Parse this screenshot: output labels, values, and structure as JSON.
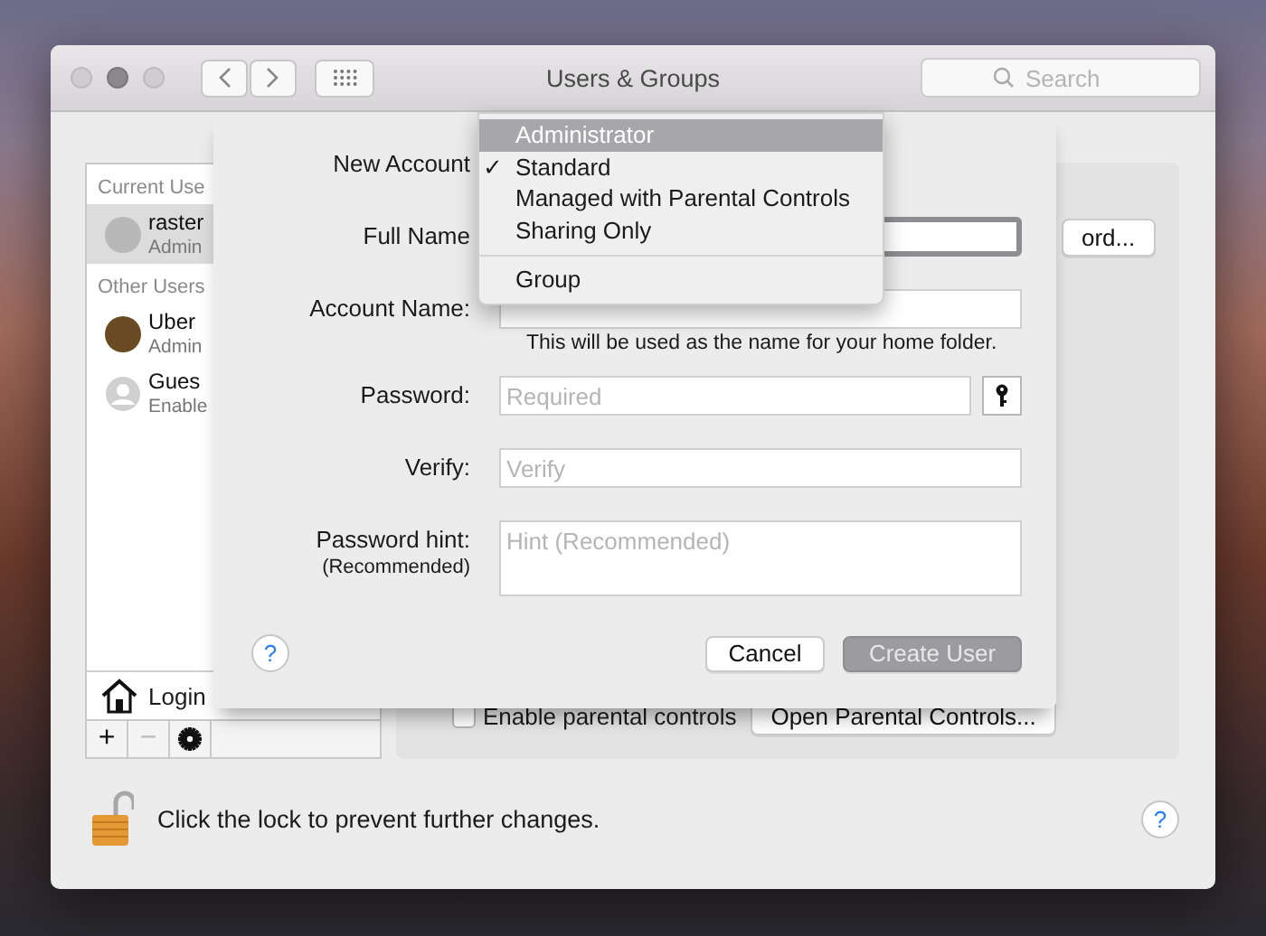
{
  "window": {
    "title": "Users & Groups",
    "search": {
      "placeholder": "Search"
    }
  },
  "sidebar": {
    "sections": [
      {
        "header": "Current Use",
        "users": [
          {
            "name": "raster",
            "role": "Admin",
            "selected": true,
            "kind": "photo"
          }
        ]
      },
      {
        "header": "Other Users",
        "users": [
          {
            "name": "Uber",
            "role": "Admin",
            "selected": false,
            "kind": "photo"
          },
          {
            "name": "Gues",
            "role": "Enable",
            "selected": false,
            "kind": "generic"
          }
        ]
      }
    ],
    "login_options": "Login",
    "toolbar": [
      {
        "kind": "text",
        "label": "+",
        "disabled": false
      },
      {
        "kind": "text",
        "label": "−",
        "disabled": true
      },
      {
        "kind": "gear",
        "disabled": false
      }
    ]
  },
  "panel": {
    "change_password_button": "ord...",
    "parental_controls": {
      "label": "Enable parental controls",
      "checked": false
    },
    "open_parental_controls_button": "Open Parental Controls..."
  },
  "sheet": {
    "new_account_label": "New Account",
    "fields": [
      {
        "kind": "text",
        "label": "Full Name",
        "focused": true
      },
      {
        "kind": "text",
        "label": "Account Name:",
        "focused": false,
        "note": "This will be used as the name for your home folder."
      },
      {
        "kind": "password",
        "label": "Password:",
        "placeholder": "Required",
        "focused": false
      },
      {
        "kind": "text",
        "label": "Verify:",
        "placeholder": "Verify",
        "focused": false
      },
      {
        "kind": "textarea",
        "label": "Password hint:",
        "sublabel": "(Recommended)",
        "placeholder": "Hint (Recommended)",
        "focused": false
      }
    ],
    "help": "?",
    "buttons": [
      {
        "label": "Cancel",
        "disabled": false
      },
      {
        "label": "Create User",
        "disabled": true
      }
    ]
  },
  "account_menu": {
    "check_mark": "✓",
    "items": [
      {
        "kind": "item",
        "label": "Administrator",
        "highlighted": true,
        "checked": false
      },
      {
        "kind": "item",
        "label": "Standard",
        "highlighted": false,
        "checked": true
      },
      {
        "kind": "item",
        "label": "Managed with Parental Controls",
        "highlighted": false,
        "checked": false
      },
      {
        "kind": "item",
        "label": "Sharing Only",
        "highlighted": false,
        "checked": false
      },
      {
        "kind": "separator"
      },
      {
        "kind": "item",
        "label": "Group",
        "highlighted": false,
        "checked": false
      }
    ]
  },
  "lock": {
    "text": "Click the lock to prevent further changes.",
    "locked": false
  },
  "help": "?"
}
